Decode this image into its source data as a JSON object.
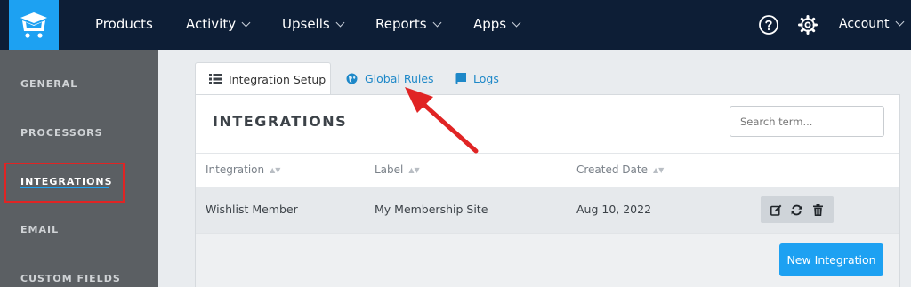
{
  "topnav": {
    "items": [
      {
        "label": "Products",
        "caret": false
      },
      {
        "label": "Activity",
        "caret": true
      },
      {
        "label": "Upsells",
        "caret": true
      },
      {
        "label": "Reports",
        "caret": true
      },
      {
        "label": "Apps",
        "caret": true
      }
    ],
    "account_label": "Account",
    "icons": [
      "help-circle-icon",
      "gear-icon"
    ]
  },
  "sidebar": {
    "items": [
      {
        "label": "GENERAL"
      },
      {
        "label": "PROCESSORS"
      },
      {
        "label": "INTEGRATIONS",
        "active": true
      },
      {
        "label": "EMAIL"
      },
      {
        "label": "CUSTOM FIELDS"
      }
    ]
  },
  "tabs": [
    {
      "label": "Integration Setup",
      "icon": "list-icon",
      "active": true
    },
    {
      "label": "Global Rules",
      "icon": "globe-icon",
      "active": false
    },
    {
      "label": "Logs",
      "icon": "book-icon",
      "active": false
    }
  ],
  "card": {
    "title": "INTEGRATIONS",
    "search_placeholder": "Search term...",
    "columns": [
      "Integration",
      "Label",
      "Created Date"
    ],
    "rows": [
      {
        "integration": "Wishlist Member",
        "label": "My Membership Site",
        "created": "Aug 10, 2022"
      }
    ],
    "row_actions": [
      "edit-icon",
      "sync-icon",
      "trash-icon"
    ],
    "new_button": "New Integration"
  },
  "colors": {
    "topnav_bg": "#0d1e36",
    "brand_blue": "#1da1f2",
    "sidebar_bg": "#5b5f63",
    "annotation_red": "#e02424",
    "link_blue": "#1e88c8"
  }
}
